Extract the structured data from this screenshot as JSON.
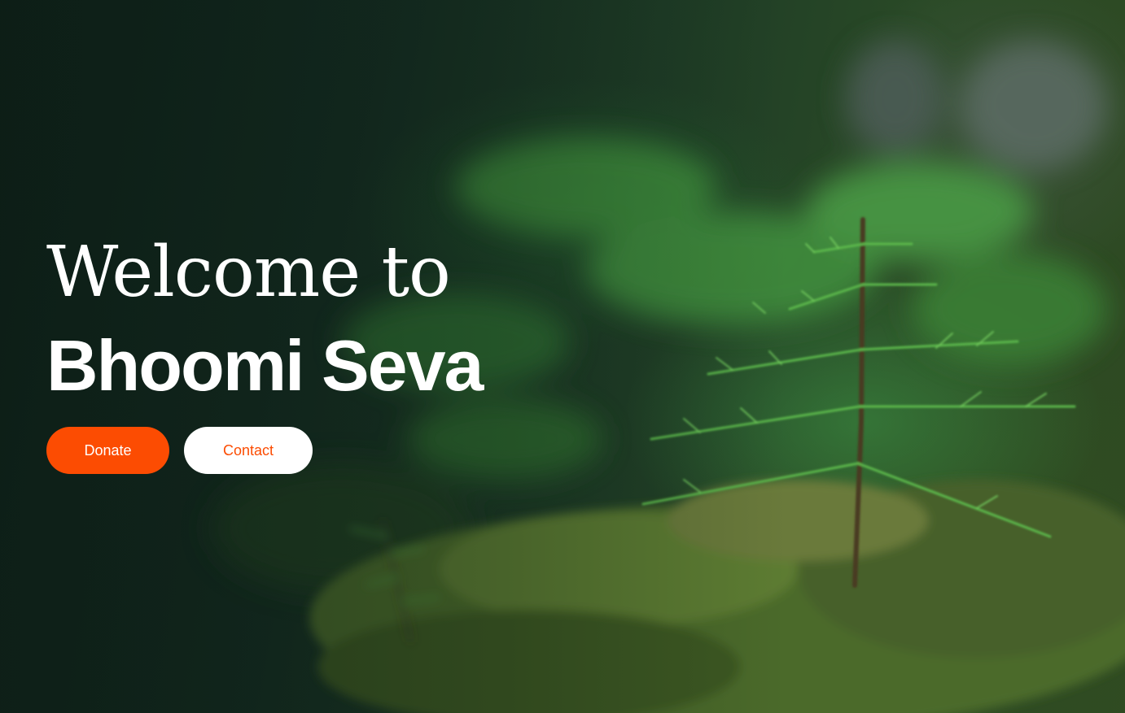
{
  "hero": {
    "welcome_line": "Welcome to",
    "brand_name": "Bhoomi Seva",
    "background": "forest-seedling-photo"
  },
  "actions": {
    "donate_label": "Donate",
    "contact_label": "Contact"
  },
  "colors": {
    "accent": "#fc4c02",
    "text": "#ffffff",
    "background": "#142a20"
  }
}
